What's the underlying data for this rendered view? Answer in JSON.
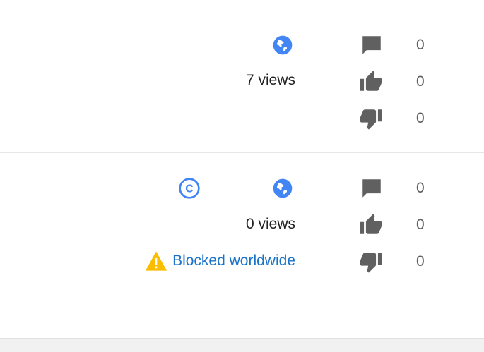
{
  "colors": {
    "globe": "#4285f4",
    "copyright": "#4285f4",
    "warning": "#fbbc04",
    "link": "#1a73c8",
    "icon_gray": "#606060"
  },
  "videos": [
    {
      "views_label": "7 views",
      "visibility_icon": "globe-icon",
      "comments": "0",
      "likes": "0",
      "dislikes": "0"
    },
    {
      "views_label": "0 views",
      "visibility_icon": "globe-icon",
      "copyright_icon": "copyright-icon",
      "restriction_label": "Blocked worldwide",
      "comments": "0",
      "likes": "0",
      "dislikes": "0"
    }
  ]
}
